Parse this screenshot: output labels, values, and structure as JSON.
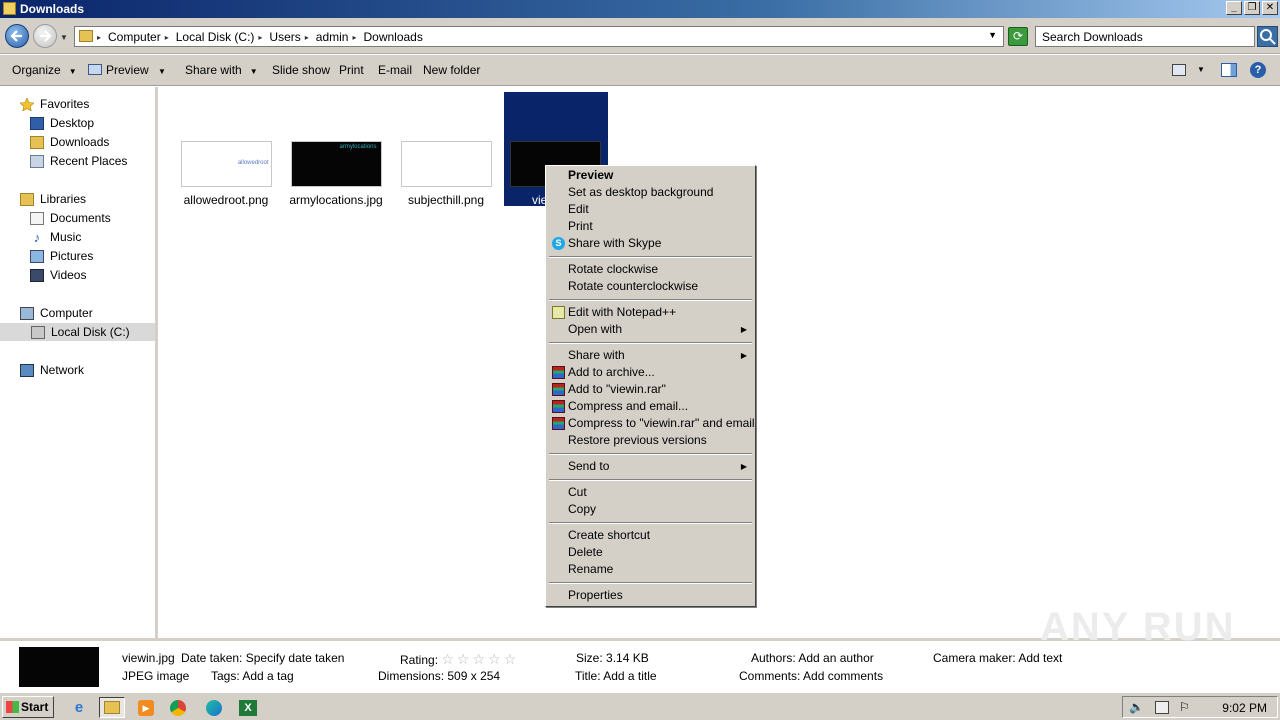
{
  "window": {
    "title": "Downloads"
  },
  "address": {
    "crumbs": [
      "Computer",
      "Local Disk (C:)",
      "Users",
      "admin",
      "Downloads"
    ],
    "search_placeholder": "Search Downloads"
  },
  "toolbar": {
    "organize": "Organize",
    "preview": "Preview",
    "share_with": "Share with",
    "slide_show": "Slide show",
    "print": "Print",
    "email": "E-mail",
    "new_folder": "New folder"
  },
  "nav": {
    "favorites": "Favorites",
    "desktop": "Desktop",
    "downloads": "Downloads",
    "recent_places": "Recent Places",
    "libraries": "Libraries",
    "documents": "Documents",
    "music": "Music",
    "pictures": "Pictures",
    "videos": "Videos",
    "computer": "Computer",
    "local_disk": "Local Disk (C:)",
    "network": "Network"
  },
  "files": [
    {
      "name": "allowedroot.png",
      "thumb_text": "allowedroot"
    },
    {
      "name": "armylocations.jpg",
      "thumb_text": "armylocations"
    },
    {
      "name": "subjecthill.png"
    },
    {
      "name": "vie"
    }
  ],
  "context_menu": {
    "preview": "Preview",
    "set_desktop_bg": "Set as desktop background",
    "edit": "Edit",
    "print": "Print",
    "share_skype": "Share with Skype",
    "rotate_cw": "Rotate clockwise",
    "rotate_ccw": "Rotate counterclockwise",
    "edit_notepad": "Edit with Notepad++",
    "open_with": "Open with",
    "share_with": "Share with",
    "add_archive": "Add to archive...",
    "add_rar": "Add to \"viewin.rar\"",
    "compress_email": "Compress and email...",
    "compress_rar_email": "Compress to \"viewin.rar\" and email",
    "restore_versions": "Restore previous versions",
    "send_to": "Send to",
    "cut": "Cut",
    "copy": "Copy",
    "create_shortcut": "Create shortcut",
    "delete": "Delete",
    "rename": "Rename",
    "properties": "Properties"
  },
  "details": {
    "filename": "viewin.jpg",
    "filetype": "JPEG image",
    "date_taken_label": "Date taken:",
    "date_taken_value": "Specify date taken",
    "tags_label": "Tags:",
    "tags_value": "Add a tag",
    "rating_label": "Rating:",
    "rating_value": 0,
    "dimensions_label": "Dimensions:",
    "dimensions_value": "509 x 254",
    "size_label": "Size:",
    "size_value": "3.14 KB",
    "title_label": "Title:",
    "title_value": "Add a title",
    "authors_label": "Authors:",
    "authors_value": "Add an author",
    "comments_label": "Comments:",
    "comments_value": "Add comments",
    "camera_label": "Camera maker:",
    "camera_value": "Add text"
  },
  "watermark": "ANY RUN",
  "taskbar": {
    "start": "Start",
    "clock": "9:02 PM"
  }
}
